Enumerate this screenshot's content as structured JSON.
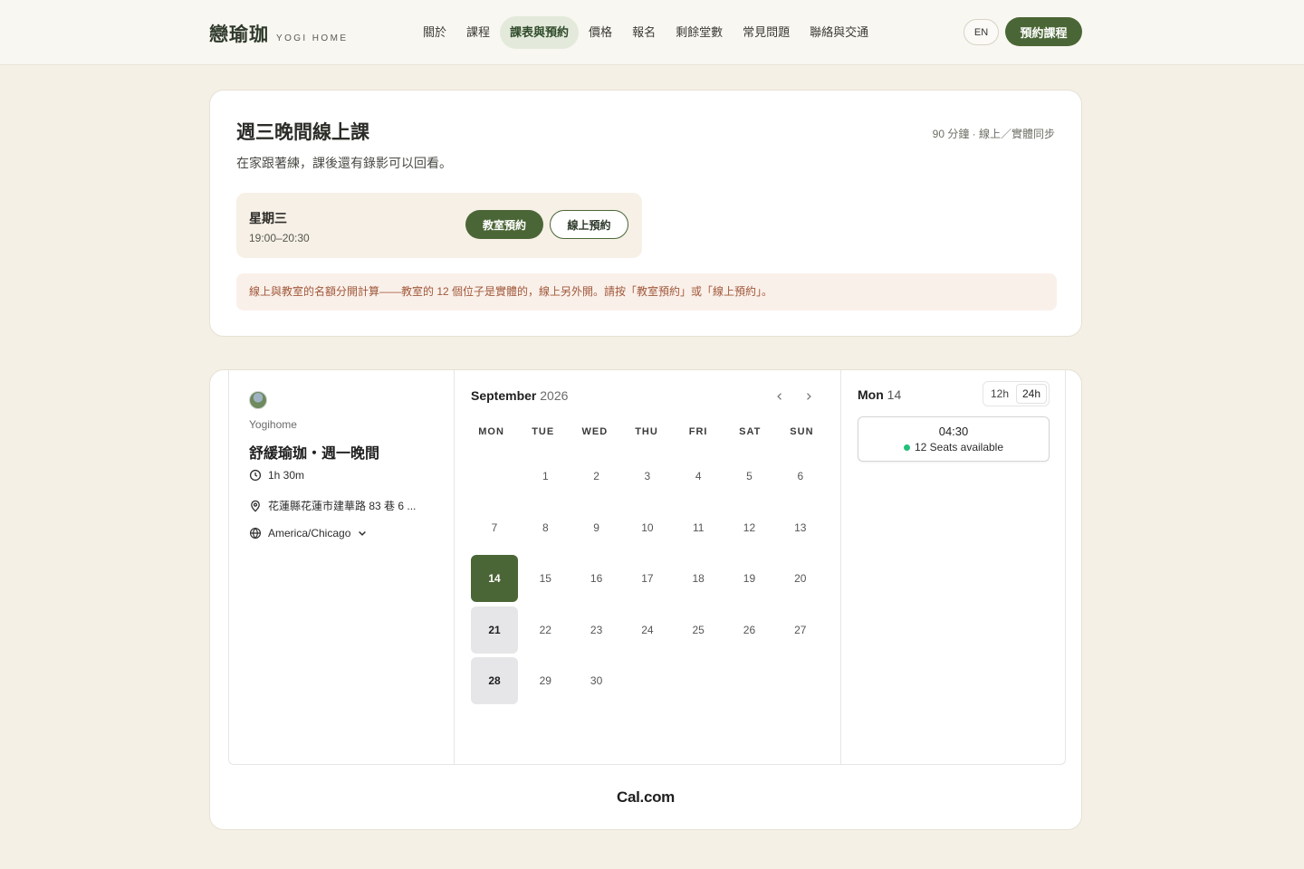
{
  "header": {
    "brand_zh": "戀瑜珈",
    "brand_en": "YOGI HOME",
    "nav": [
      {
        "label": "關於"
      },
      {
        "label": "課程"
      },
      {
        "label": "課表與預約"
      },
      {
        "label": "價格"
      },
      {
        "label": "報名"
      },
      {
        "label": "剩餘堂數"
      },
      {
        "label": "常見問題"
      },
      {
        "label": "聯絡與交通"
      }
    ],
    "active_nav": "課表與預約",
    "lang_label": "EN",
    "cta_label": "預約課程"
  },
  "class_card": {
    "title": "週三晚間線上課",
    "subtitle": "在家跟著練，課後還有錄影可以回看。",
    "meta": "90 分鐘 · 線上／實體同步",
    "session": {
      "day": "星期三",
      "time": "19:00–20:30",
      "studio_button": "教室預約",
      "online_button": "線上預約"
    },
    "notice": "線上與教室的名額分開計算——教室的 12 個位子是實體的，線上另外開。請按「教室預約」或「線上預約」。"
  },
  "booking": {
    "organizer": "Yogihome",
    "event_title": "舒緩瑜珈・週一晚間",
    "duration": "1h 30m",
    "location": "花蓮縣花蓮市建華路 83 巷 6 ...",
    "timezone": "America/Chicago",
    "month": "September",
    "year": "2026",
    "weekdays": [
      "MON",
      "TUE",
      "WED",
      "THU",
      "FRI",
      "SAT",
      "SUN"
    ],
    "days": [
      {
        "n": "",
        "state": "empty"
      },
      {
        "n": "1",
        "state": "normal"
      },
      {
        "n": "2",
        "state": "normal"
      },
      {
        "n": "3",
        "state": "normal"
      },
      {
        "n": "4",
        "state": "normal"
      },
      {
        "n": "5",
        "state": "normal"
      },
      {
        "n": "6",
        "state": "normal"
      },
      {
        "n": "7",
        "state": "normal"
      },
      {
        "n": "8",
        "state": "normal"
      },
      {
        "n": "9",
        "state": "normal"
      },
      {
        "n": "10",
        "state": "normal"
      },
      {
        "n": "11",
        "state": "normal"
      },
      {
        "n": "12",
        "state": "normal"
      },
      {
        "n": "13",
        "state": "normal"
      },
      {
        "n": "14",
        "state": "selected"
      },
      {
        "n": "15",
        "state": "normal"
      },
      {
        "n": "16",
        "state": "normal"
      },
      {
        "n": "17",
        "state": "normal"
      },
      {
        "n": "18",
        "state": "normal"
      },
      {
        "n": "19",
        "state": "normal"
      },
      {
        "n": "20",
        "state": "normal"
      },
      {
        "n": "21",
        "state": "avail"
      },
      {
        "n": "22",
        "state": "normal"
      },
      {
        "n": "23",
        "state": "normal"
      },
      {
        "n": "24",
        "state": "normal"
      },
      {
        "n": "25",
        "state": "normal"
      },
      {
        "n": "26",
        "state": "normal"
      },
      {
        "n": "27",
        "state": "normal"
      },
      {
        "n": "28",
        "state": "avail"
      },
      {
        "n": "29",
        "state": "normal"
      },
      {
        "n": "30",
        "state": "normal"
      }
    ],
    "selected_day_name": "Mon",
    "selected_day_num": "14",
    "format_12": "12h",
    "format_24": "24h",
    "active_format": "24h",
    "slot_time": "04:30",
    "slot_seats": "12 Seats available",
    "powered_by": "Cal.com"
  },
  "colors": {
    "brand_green": "#4b6636",
    "page_bg": "#f4f0e6",
    "notice_text": "#a0583a",
    "seat_dot": "#22c07a"
  }
}
